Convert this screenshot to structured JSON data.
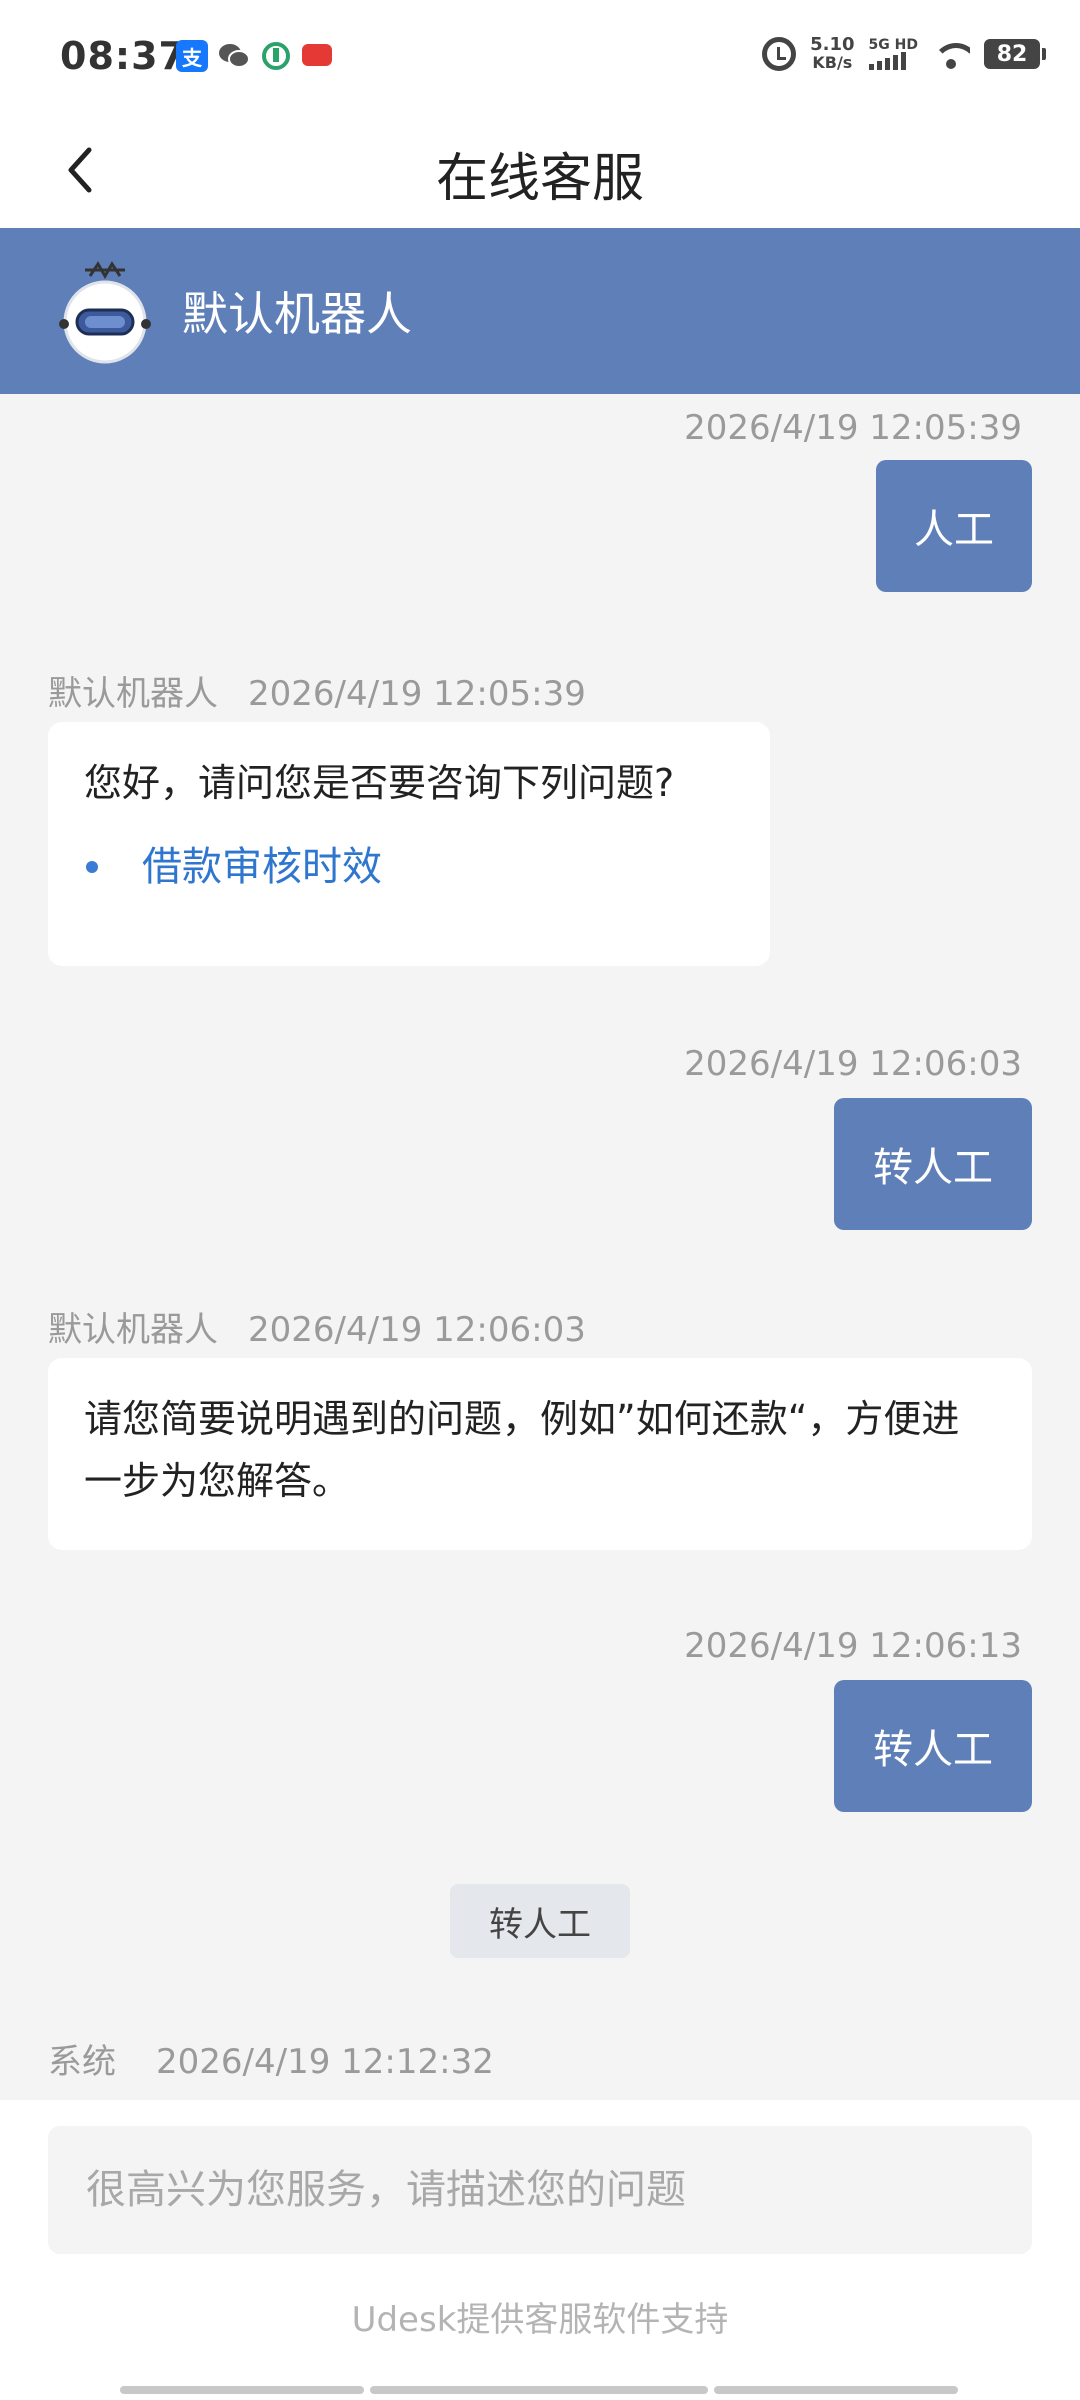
{
  "status_bar": {
    "time": "08:37",
    "speed_value": "5.10",
    "speed_unit": "KB/s",
    "network": "5G HD",
    "battery": "82",
    "notification_icons": [
      "alipay-icon",
      "wechat-icon",
      "app-icon",
      "app-badge-icon"
    ]
  },
  "header": {
    "title": "在线客服",
    "back_icon": "chevron-left-icon"
  },
  "bot_bar": {
    "name": "默认机器人",
    "avatar_icon": "robot-icon",
    "color": "#5f7fb8"
  },
  "messages": [
    {
      "type": "user",
      "timestamp": "2026/4/19 12:05:39",
      "text": "人工"
    },
    {
      "type": "bot",
      "sender": "默认机器人",
      "timestamp": "2026/4/19 12:05:39",
      "text": "您好，请问您是否要咨询下列问题?",
      "links": [
        "借款审核时效"
      ]
    },
    {
      "type": "user",
      "timestamp": "2026/4/19 12:06:03",
      "text": "转人工"
    },
    {
      "type": "bot",
      "sender": "默认机器人",
      "timestamp": "2026/4/19 12:06:03",
      "text": "请您简要说明遇到的问题，例如”如何还款“，方便进一步为您解答。"
    },
    {
      "type": "user",
      "timestamp": "2026/4/19 12:06:13",
      "text": "转人工"
    },
    {
      "type": "system_pill",
      "text": "转人工"
    },
    {
      "type": "system",
      "sender": "系统",
      "timestamp": "2026/4/19 12:12:32"
    }
  ],
  "input": {
    "placeholder": "很高兴为您服务，请描述您的问题",
    "value": ""
  },
  "footer": {
    "powered_by": "Udesk提供客服软件支持"
  }
}
